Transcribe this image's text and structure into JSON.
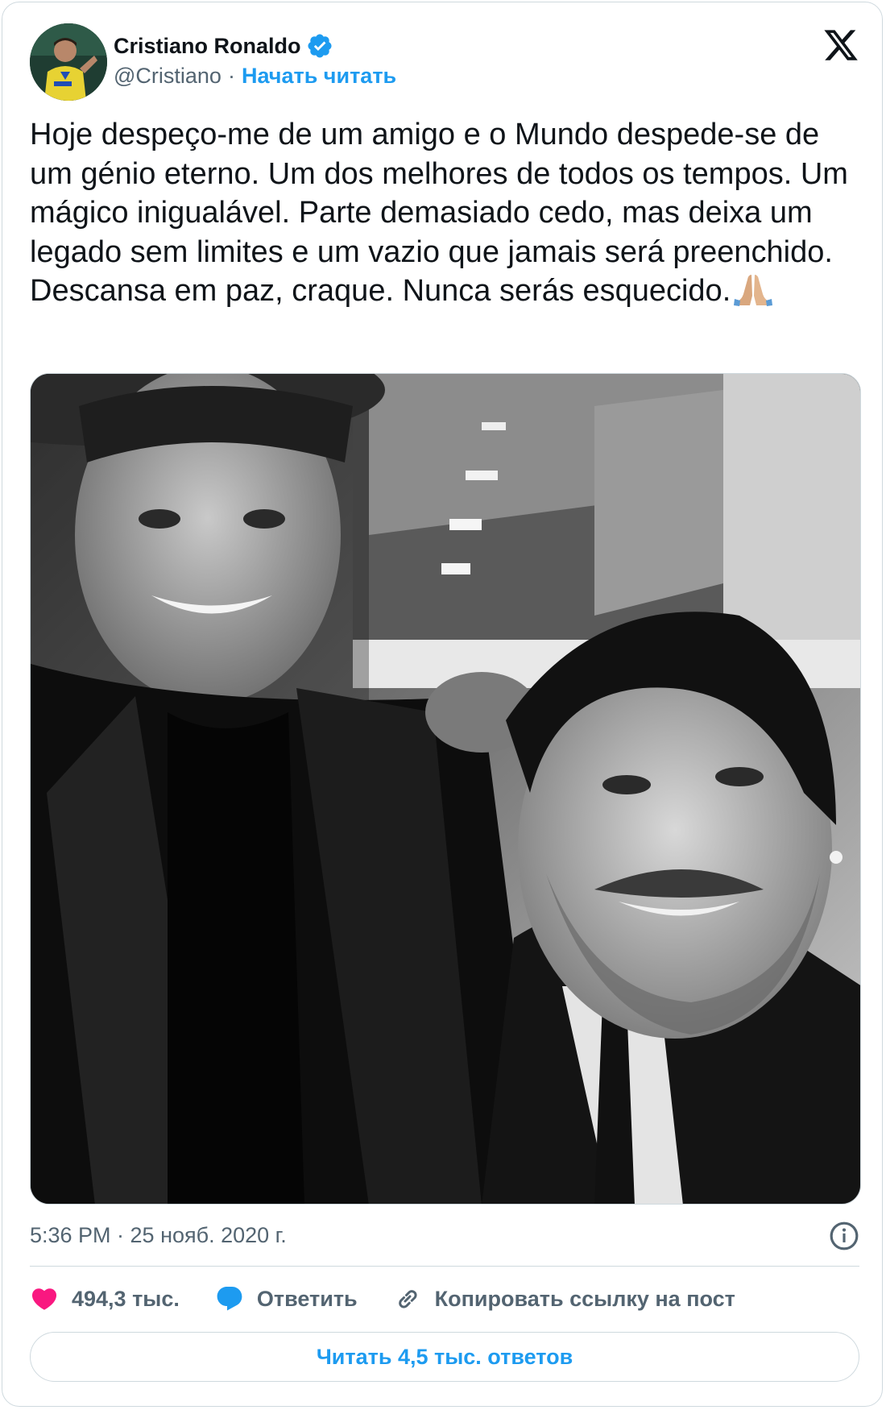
{
  "author": {
    "name": "Cristiano Ronaldo",
    "handle": "@Cristiano",
    "separator": "·",
    "follow_label": "Начать читать",
    "verified": true
  },
  "tweet": {
    "text": "Hoje despeço-me de um amigo e o Mundo despede-se de um génio eterno. Um dos melhores de todos os tempos. Um mágico inigualável. Parte demasiado cedo, mas deixa um legado sem limites e um vazio que jamais será preenchido. Descansa em paz, craque. Nunca serás esquecido.",
    "emoji": "folded-hands-emoji"
  },
  "timestamp": "5:36 PM · 25 нояб. 2020 г.",
  "actions": {
    "likes": "494,3 тыс.",
    "reply_label": "Ответить",
    "copy_link_label": "Копировать ссылку на пост"
  },
  "read_replies_label": "Читать 4,5 тыс. ответов",
  "colors": {
    "accent": "#1d9bf0",
    "like": "#f91880",
    "text": "#0f1419",
    "secondary": "#536471",
    "border": "#cfd9de"
  }
}
